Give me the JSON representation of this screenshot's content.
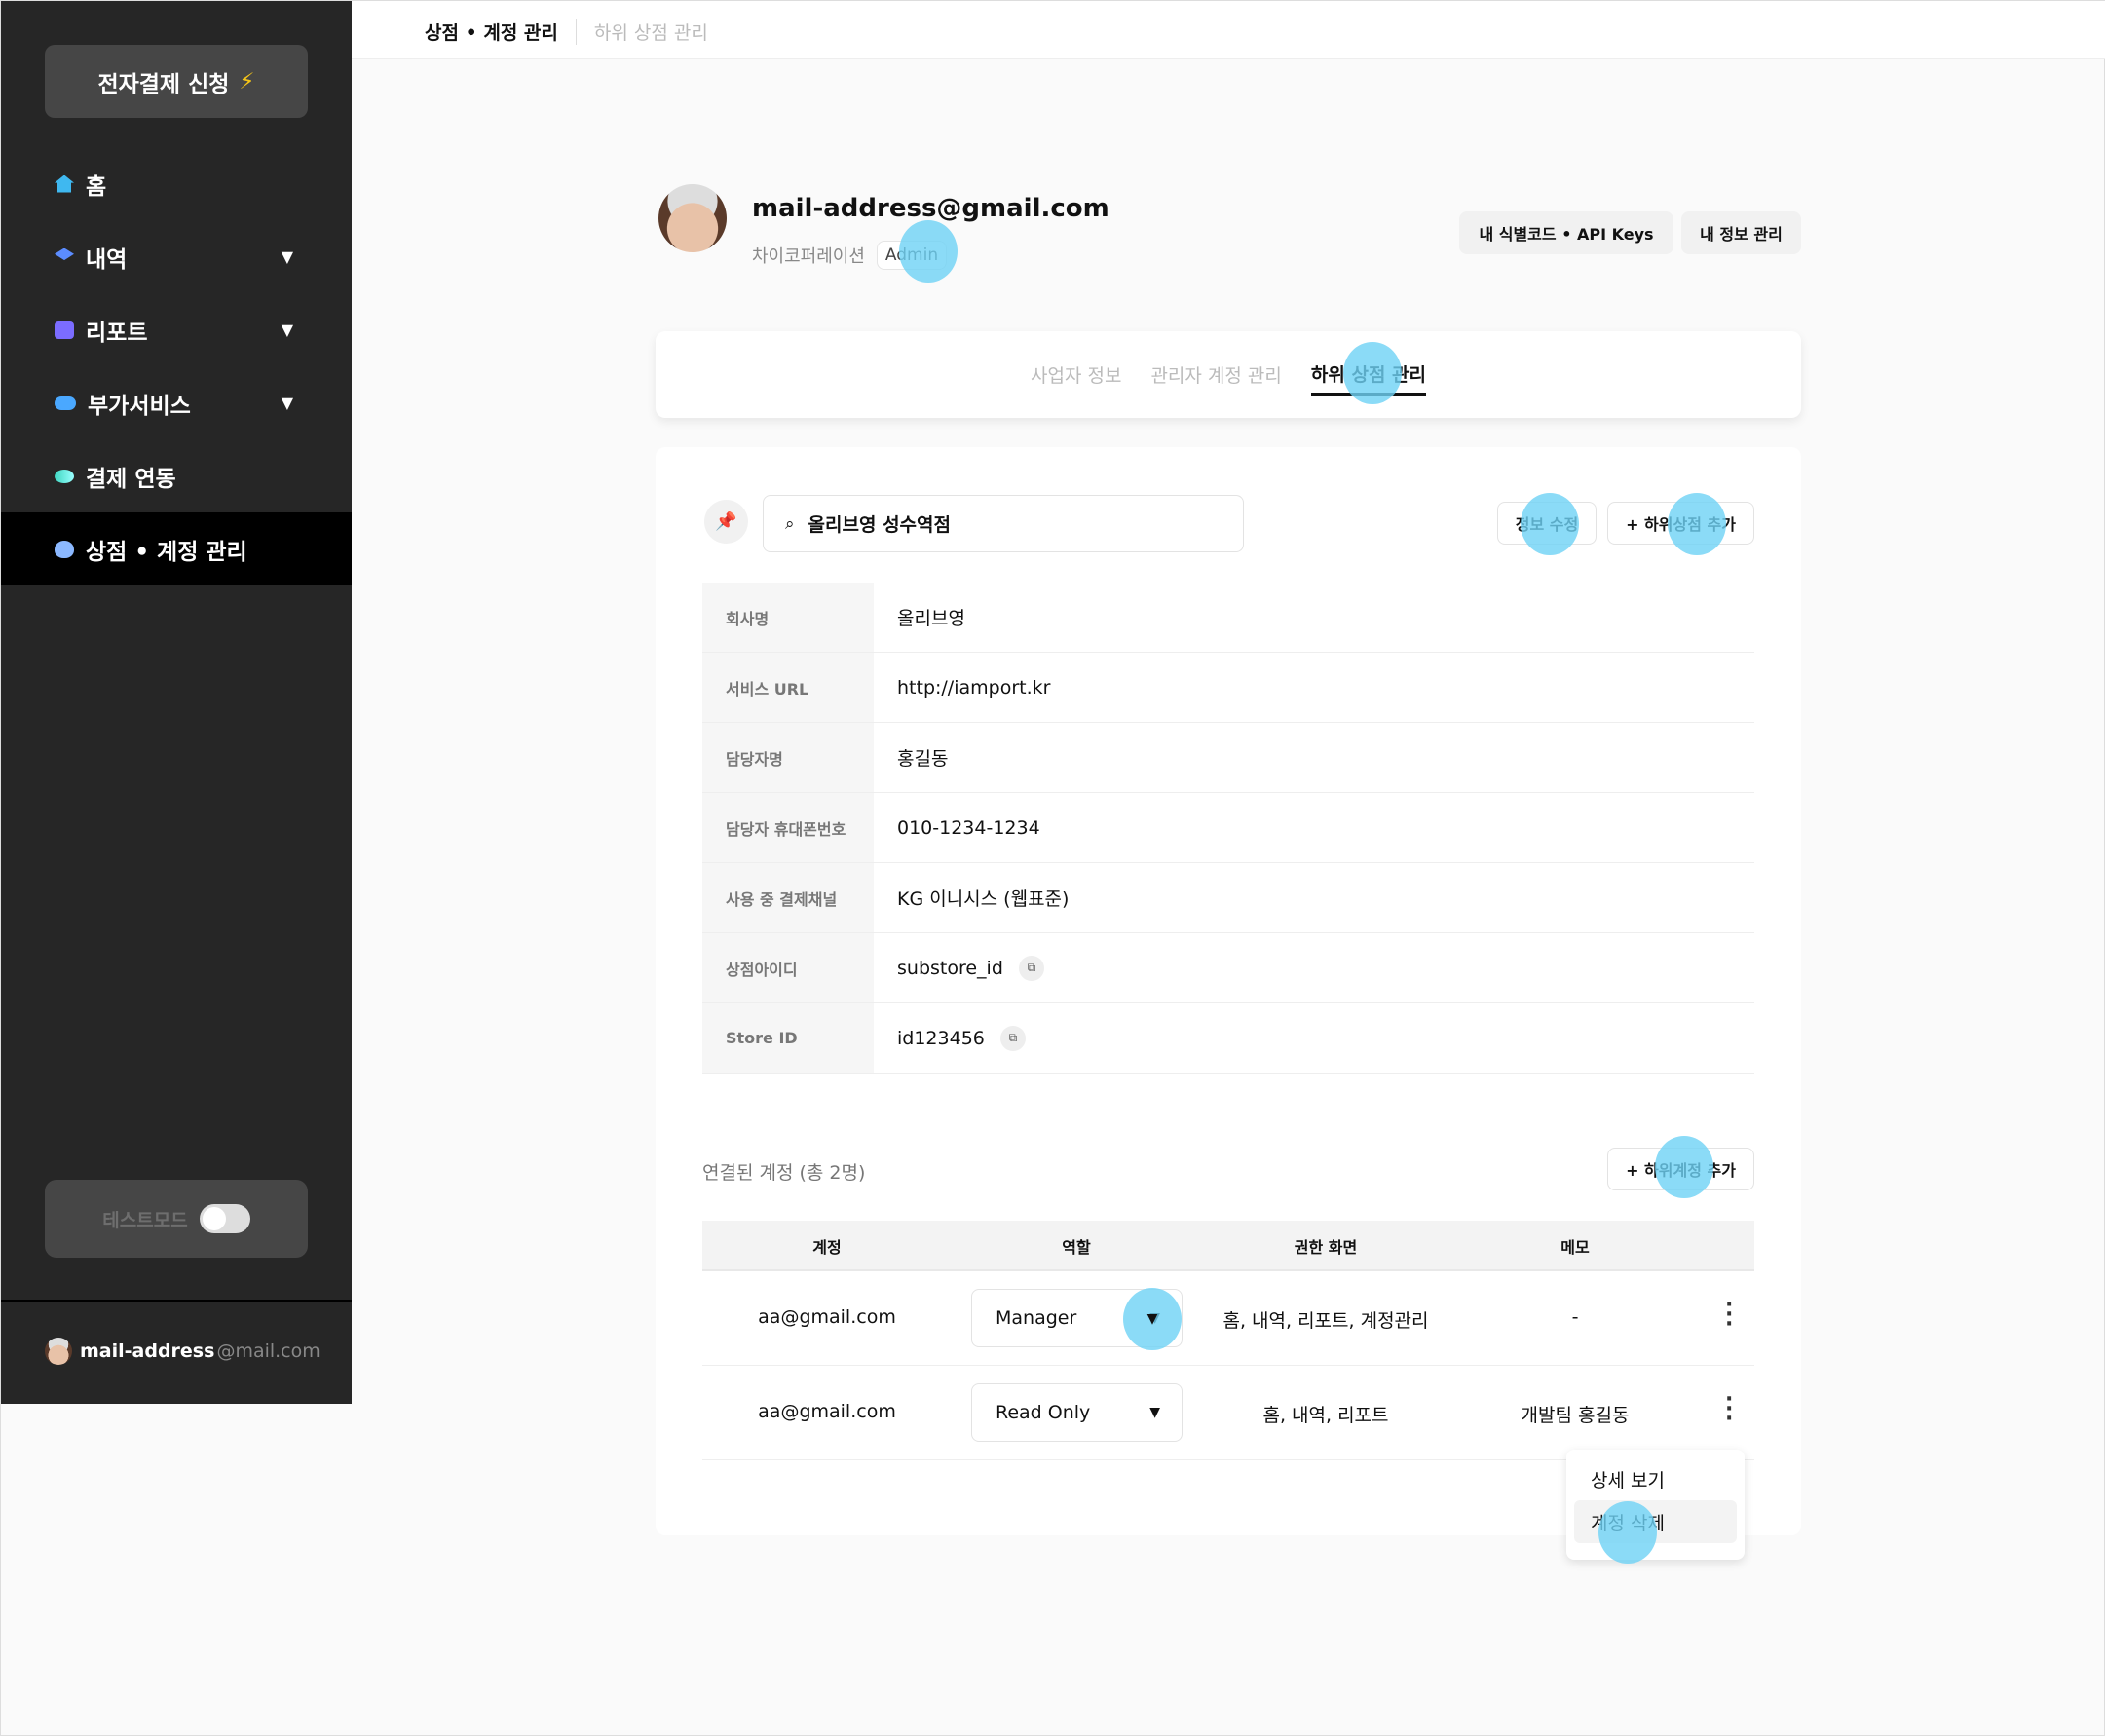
{
  "sidebar": {
    "apply_button": "전자결제 신청",
    "items": [
      {
        "label": "홈",
        "icon": "home-icon",
        "color": "#3fb8f0"
      },
      {
        "label": "내역",
        "icon": "layers-icon",
        "color": "#5b8cff",
        "has_submenu": true
      },
      {
        "label": "리포트",
        "icon": "chart-icon",
        "color": "#7b6cff",
        "has_submenu": true
      },
      {
        "label": "부가서비스",
        "icon": "toggle-icon",
        "color": "#4aa8ff",
        "has_submenu": true
      },
      {
        "label": "결제 연동",
        "icon": "link-icon",
        "color": "#3ed6c0"
      },
      {
        "label": "상점 • 계정 관리",
        "icon": "drop-icon",
        "color": "#8bb8ff",
        "active": true
      }
    ],
    "test_mode": {
      "label": "테스트모드",
      "enabled": false
    },
    "footer": {
      "user": "mail-address",
      "domain": "@mail.com"
    }
  },
  "breadcrumb": {
    "current": "상점 • 계정 관리",
    "sub": "하위 상점 관리"
  },
  "profile": {
    "email": "mail-address@gmail.com",
    "company": "차이코퍼레이션",
    "role": "Admin"
  },
  "header_buttons": {
    "api_keys": "내 식별코드 • API Keys",
    "my_info": "내 정보 관리"
  },
  "tabs": [
    {
      "label": "사업자 정보"
    },
    {
      "label": "관리자 계정 관리"
    },
    {
      "label": "하위 상점 관리",
      "active": true
    }
  ],
  "store": {
    "search_value": "올리브영 성수역점",
    "edit_button": "정보 수정",
    "add_store_button": "+ 하위상점 추가",
    "fields": [
      {
        "label": "회사명",
        "value": "올리브영"
      },
      {
        "label": "서비스 URL",
        "value": "http://iamport.kr"
      },
      {
        "label": "담당자명",
        "value": "홍길동"
      },
      {
        "label": "담당자 휴대폰번호",
        "value": "010-1234-1234"
      },
      {
        "label": "사용 중 결제채널",
        "value": "KG 이니시스 (웹표준)"
      },
      {
        "label": "상점아이디",
        "value": "substore_id",
        "copy": true
      },
      {
        "label": "Store ID",
        "value": "id123456",
        "copy": true
      }
    ]
  },
  "accounts": {
    "title": "연결된 계정 (총 2명)",
    "add_button": "+ 하위계정 추가",
    "columns": [
      "계정",
      "역할",
      "권한 화면",
      "메모"
    ],
    "rows": [
      {
        "account": "aa@gmail.com",
        "role": "Manager",
        "screens": "홈, 내역, 리포트, 계정관리",
        "memo": "-"
      },
      {
        "account": "aa@gmail.com",
        "role": "Read Only",
        "screens": "홈, 내역, 리포트",
        "memo": "개발팀 홍길동"
      }
    ],
    "row_menu": [
      "상세 보기",
      "계정 삭제"
    ]
  },
  "colors": {
    "sidebar_bg": "#262626",
    "touch_indicator": "#6ed2f5",
    "bolt": "#f5c518"
  }
}
